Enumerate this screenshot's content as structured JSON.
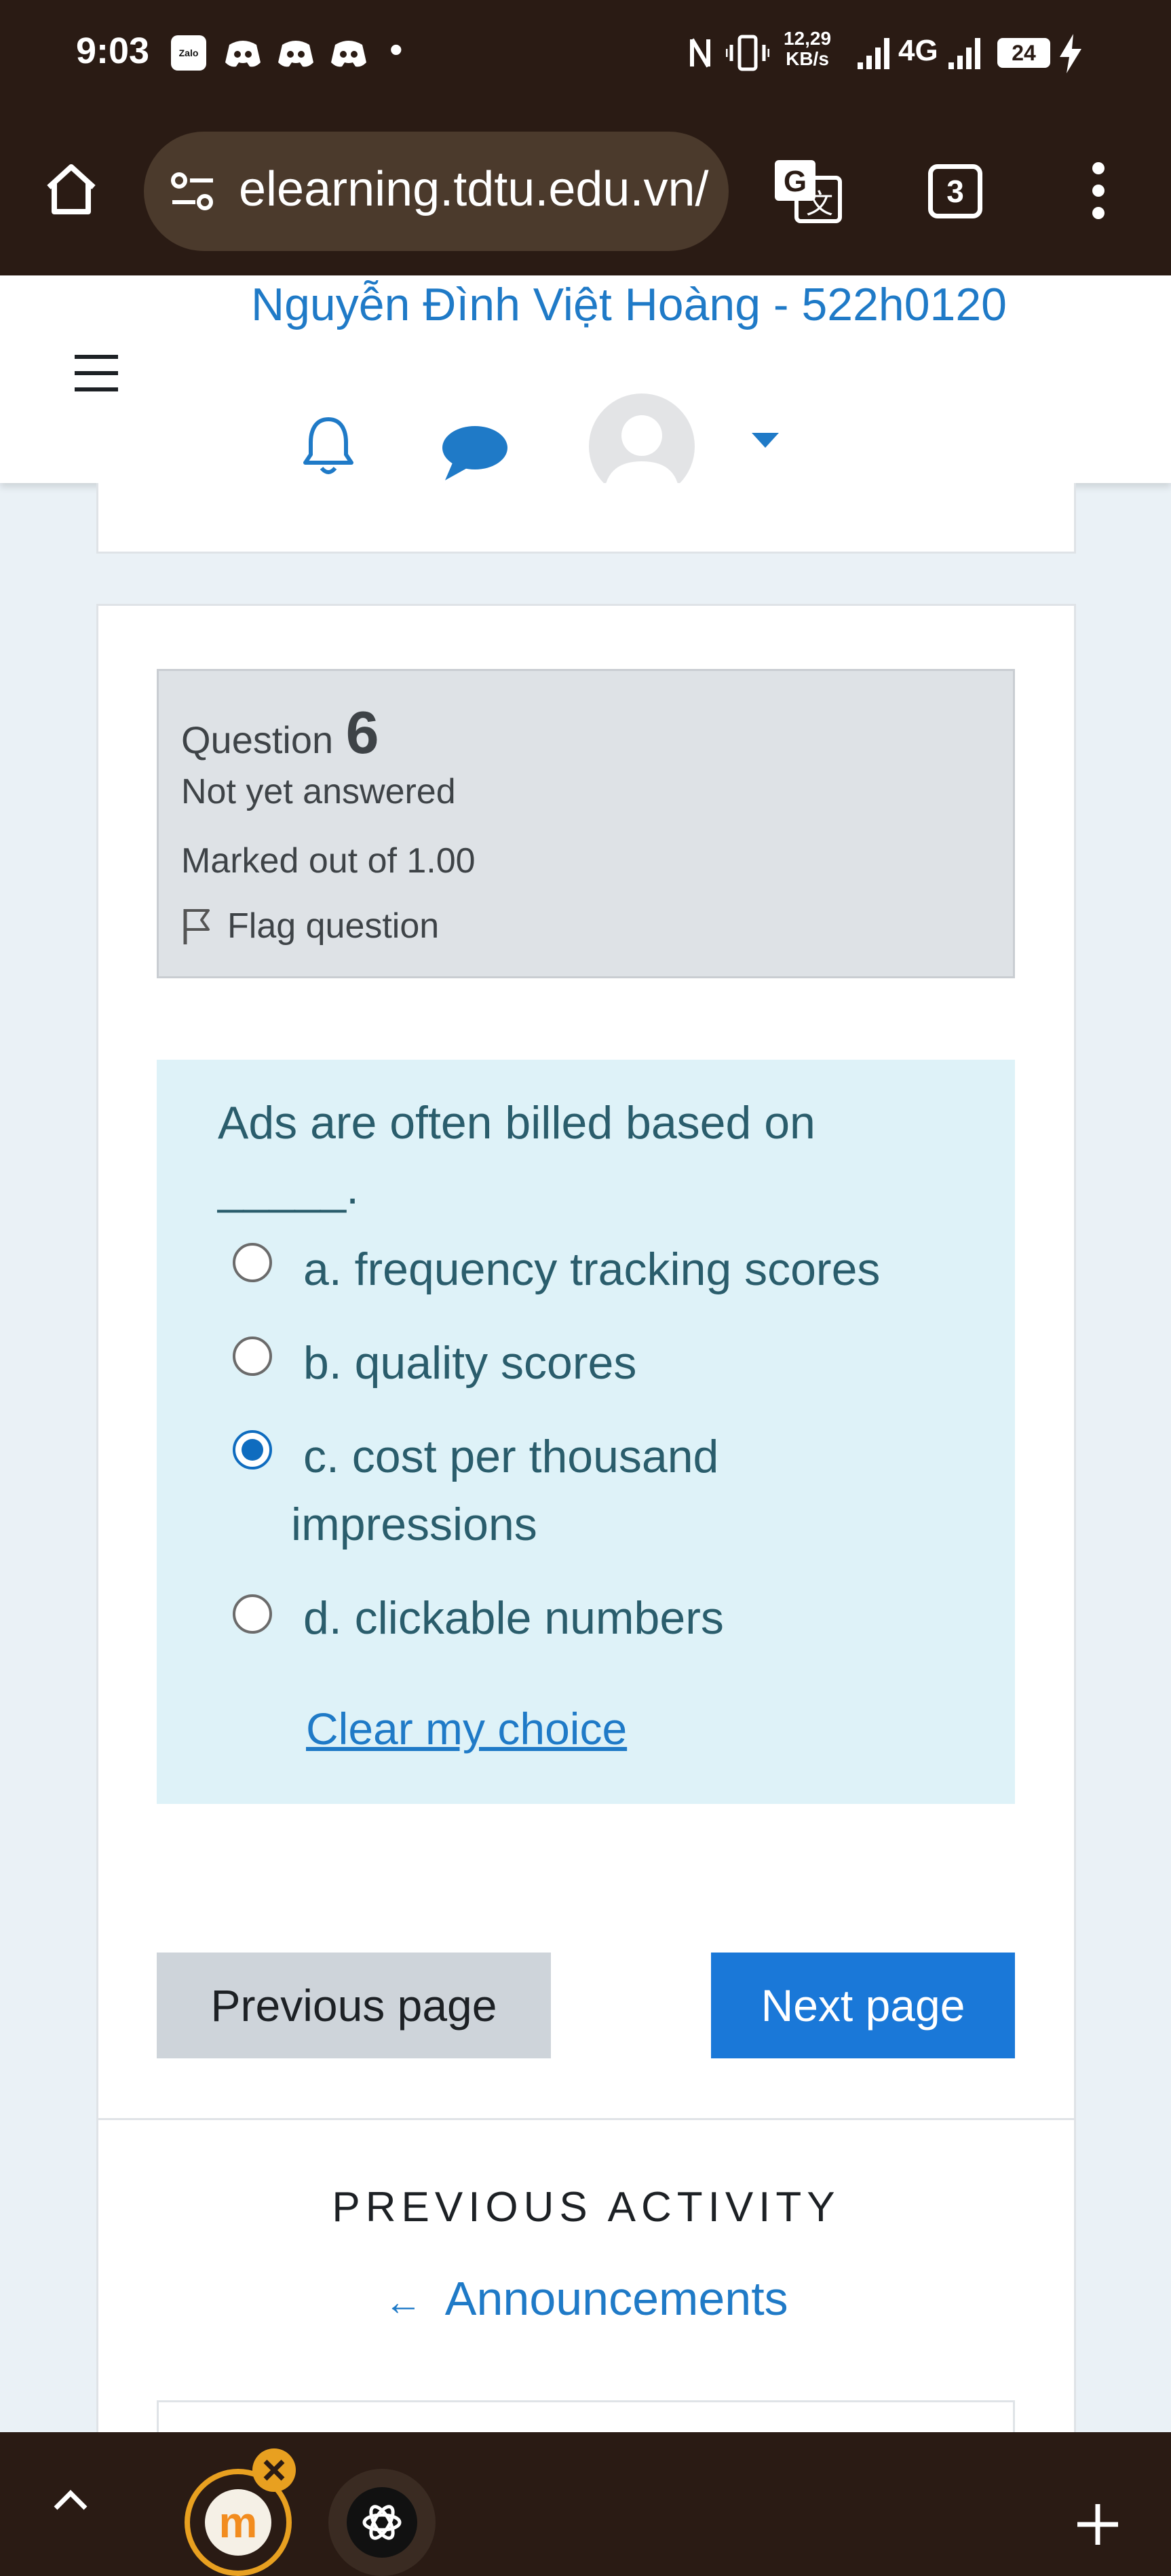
{
  "status_bar": {
    "time": "9:03",
    "app_icons": [
      "zalo-icon",
      "discord-icon",
      "discord-icon",
      "discord-icon"
    ],
    "app_icon_text": "Zalo",
    "dot": "•",
    "net_speed_value": "12,29",
    "net_speed_unit": "KB/s",
    "network": "4G",
    "battery": "24"
  },
  "browser": {
    "url": "elearning.tdtu.edu.vn/",
    "tab_count": "3",
    "icons": [
      "home-icon",
      "site-settings-icon",
      "translate-icon",
      "tabs-icon",
      "more-vert-icon"
    ]
  },
  "header": {
    "user_name": "Nguyễn Đình Việt Hoàng - 522h0120",
    "icons": [
      "menu-icon",
      "bell-icon",
      "chat-icon",
      "avatar",
      "caret-down-icon"
    ]
  },
  "question": {
    "label": "Question",
    "number": "6",
    "state": "Not yet answered",
    "mark": "Marked out of 1.00",
    "flag": "Flag question",
    "text_line1": "Ads are often billed based on",
    "text_line2": "_____.",
    "options": [
      {
        "line1": "a. frequency tracking scores",
        "line2": "",
        "selected": false
      },
      {
        "line1": "b. quality scores",
        "line2": "",
        "selected": false
      },
      {
        "line1": "c. cost per thousand",
        "line2": "impressions",
        "selected": true
      },
      {
        "line1": "d. clickable numbers",
        "line2": "",
        "selected": false
      }
    ],
    "clear": "Clear my choice"
  },
  "nav": {
    "prev": "Previous page",
    "next": "Next page"
  },
  "activity": {
    "heading": "PREVIOUS ACTIVITY",
    "arrow": "←",
    "link": "Announcements"
  },
  "bottom_bar": {
    "icons": [
      "chevron-up-icon",
      "moodle-app-icon",
      "close-badge-icon",
      "chatgpt-icon",
      "plus-icon"
    ],
    "moodle_letter": "m"
  },
  "colors": {
    "chrome_bg": "#2a1b14",
    "link_blue": "#1f7ac7",
    "primary_button": "#1a78d8",
    "question_bg": "#def2f8",
    "info_bg": "#dee2e6"
  }
}
